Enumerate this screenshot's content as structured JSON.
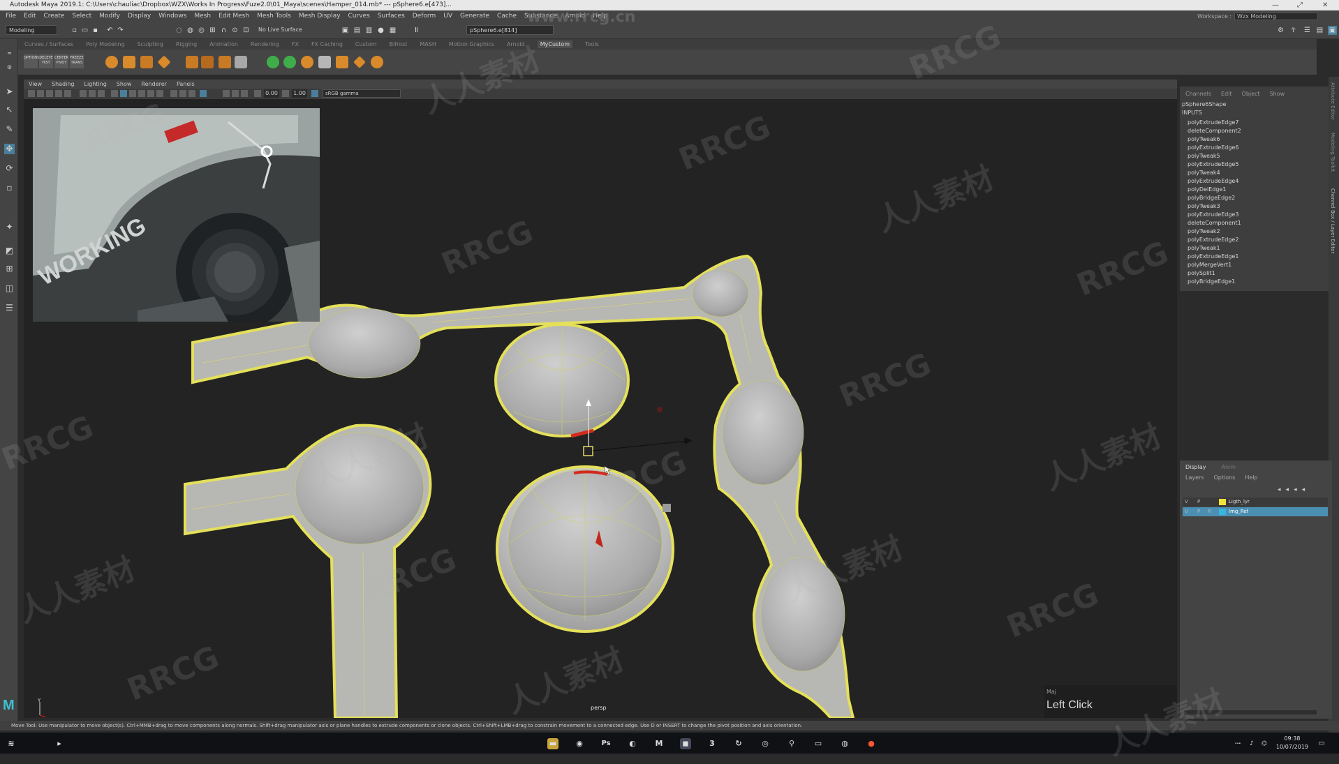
{
  "title_bar": {
    "text": "Autodesk Maya 2019.1: C:\\Users\\chauliac\\Dropbox\\WZX\\Works In Progress\\Fuze2.0\\01_Maya\\scenes\\Hamper_014.mb*  ---  pSphere6.e[473]...",
    "minimize": "—",
    "maximize": "⤢",
    "close": "✕"
  },
  "menu_bar": [
    "File",
    "Edit",
    "Create",
    "Select",
    "Modify",
    "Display",
    "Windows",
    "Mesh",
    "Edit Mesh",
    "Mesh Tools",
    "Mesh Display",
    "Curves",
    "Surfaces",
    "Deform",
    "UV",
    "Generate",
    "Cache",
    "Substance",
    "Arnold",
    "Help"
  ],
  "workspace": {
    "label": "Workspace :",
    "value": "Wzx Modeling"
  },
  "status_line": {
    "mode": "Modeling",
    "live_surface": "No Live Surface",
    "selection_field": "pSphere6.e[814]"
  },
  "shelf_tabs": [
    "Curves / Surfaces",
    "Poly Modeling",
    "Sculpting",
    "Rigging",
    "Animation",
    "Rendering",
    "FX",
    "FX Caching",
    "Custom",
    "Bifrost",
    "MASH",
    "Motion Graphics",
    "Arnold",
    "MyCustom",
    "Tools"
  ],
  "shelf_active": "MyCustom",
  "shelf_labels": [
    "OPTIONS",
    "DELETE HIST",
    "CENTER PIVOT",
    "FREEZE TRANS"
  ],
  "panel_menu": [
    "View",
    "Shading",
    "Lighting",
    "Show",
    "Renderer",
    "Panels"
  ],
  "panel_fields": {
    "exposure": "0.00",
    "gamma": "1.00",
    "color_space": "sRGB gamma"
  },
  "viewport": {
    "camera_label": "persp",
    "hud_key": "Maj",
    "hud_action": "Left Click"
  },
  "channel_box": {
    "menu": [
      "Channels",
      "Edit",
      "Object",
      "Show"
    ],
    "node": "pSphere6Shape",
    "inputs_label": "INPUTS",
    "inputs": [
      "polyExtrudeEdge7",
      "deleteComponent2",
      "polyTweak6",
      "polyExtrudeEdge6",
      "polyTweak5",
      "polyExtrudeEdge5",
      "polyTweak4",
      "polyExtrudeEdge4",
      "polyDelEdge1",
      "polyBridgeEdge2",
      "polyTweak3",
      "polyExtrudeEdge3",
      "deleteComponent1",
      "polyTweak2",
      "polyExtrudeEdge2",
      "polyTweak1",
      "polyExtrudeEdge1",
      "polyMergeVert1",
      "polySplit1",
      "polyBridgeEdge1"
    ]
  },
  "side_tabs": [
    "Attribute Editor",
    "Modeling Toolkit",
    "Channel Box / Layer Editor"
  ],
  "layer_editor": {
    "tabs": [
      "Display",
      "Anim"
    ],
    "menu": [
      "Layers",
      "Options",
      "Help"
    ],
    "layers": [
      {
        "v": "V",
        "p": "P",
        "r": "",
        "name": "Ligth_lyr",
        "color": "#f2e33a"
      },
      {
        "v": "V",
        "p": "P",
        "r": "R",
        "name": "Img_Ref",
        "color": "#39b6e0"
      }
    ]
  },
  "help_line": "Move Tool: Use manipulator to move object(s). Ctrl+MMB+drag to move components along normals. Shift+drag manipulator axis or plane handles to extrude components or clone objects. Ctrl+Shift+LMB+drag to constrain movement to a connected edge. Use D or INSERT to change the pivot position and axis orientation.",
  "taskbar": {
    "time": "09:38",
    "date": "10/07/2019"
  },
  "watermarks": {
    "site": "www.rrcg.cn",
    "brand": "RRCG",
    "cn": "人人素材"
  },
  "reference_image_text": "WORKING"
}
